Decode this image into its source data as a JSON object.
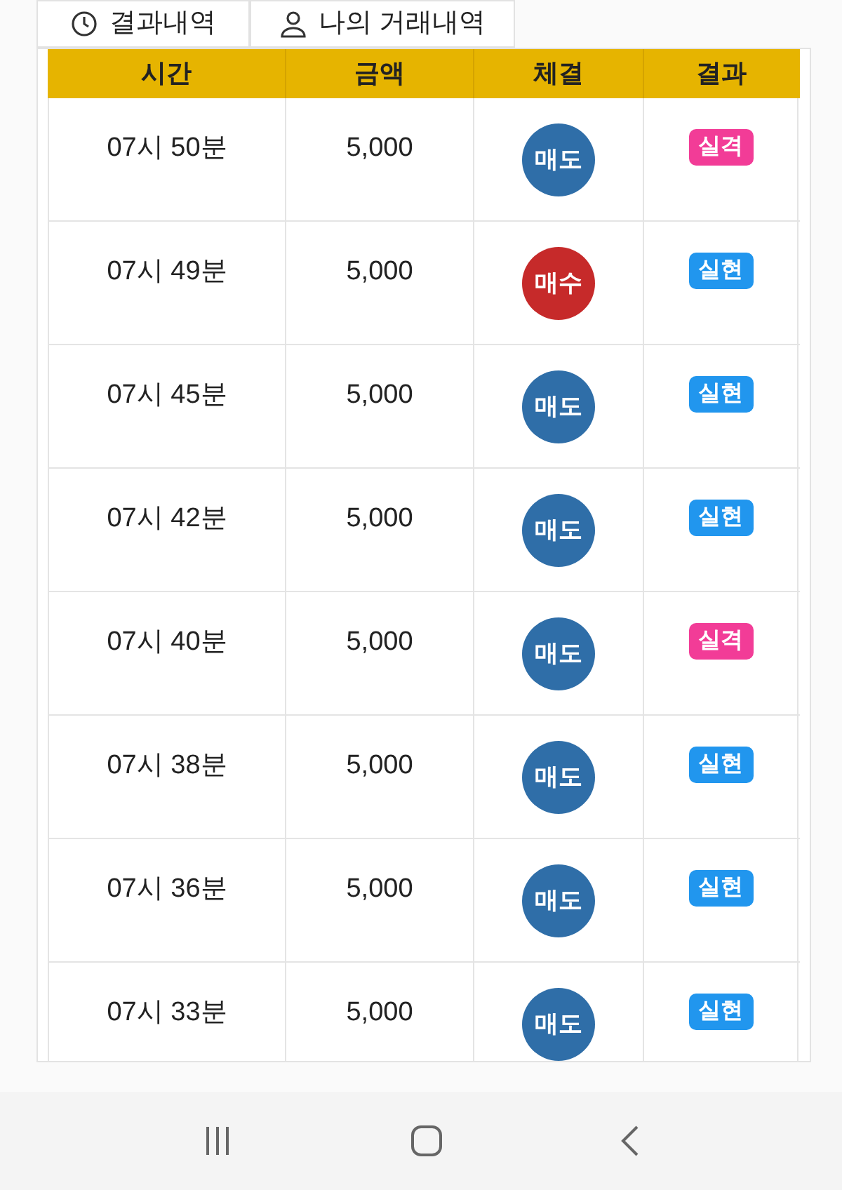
{
  "tabs": [
    {
      "label": "결과내역",
      "selected": false
    },
    {
      "label": "나의 거래내역",
      "selected": false
    }
  ],
  "table": {
    "columns": [
      "시간",
      "금액",
      "체결",
      "결과"
    ],
    "rows": [
      {
        "time": "07시 50분",
        "amount": "5,000",
        "side": {
          "label": "매도",
          "kind": "sell"
        },
        "result": {
          "label": "실격",
          "kind": "fail"
        }
      },
      {
        "time": "07시 49분",
        "amount": "5,000",
        "side": {
          "label": "매수",
          "kind": "buy"
        },
        "result": {
          "label": "실현",
          "kind": "win"
        }
      },
      {
        "time": "07시 45분",
        "amount": "5,000",
        "side": {
          "label": "매도",
          "kind": "sell"
        },
        "result": {
          "label": "실현",
          "kind": "win"
        }
      },
      {
        "time": "07시 42분",
        "amount": "5,000",
        "side": {
          "label": "매도",
          "kind": "sell"
        },
        "result": {
          "label": "실현",
          "kind": "win"
        }
      },
      {
        "time": "07시 40분",
        "amount": "5,000",
        "side": {
          "label": "매도",
          "kind": "sell"
        },
        "result": {
          "label": "실격",
          "kind": "fail"
        }
      },
      {
        "time": "07시 38분",
        "amount": "5,000",
        "side": {
          "label": "매도",
          "kind": "sell"
        },
        "result": {
          "label": "실현",
          "kind": "win"
        }
      },
      {
        "time": "07시 36분",
        "amount": "5,000",
        "side": {
          "label": "매도",
          "kind": "sell"
        },
        "result": {
          "label": "실현",
          "kind": "win"
        }
      },
      {
        "time": "07시 33분",
        "amount": "5,000",
        "side": {
          "label": "매도",
          "kind": "sell"
        },
        "result": {
          "label": "실현",
          "kind": "win"
        }
      }
    ]
  }
}
